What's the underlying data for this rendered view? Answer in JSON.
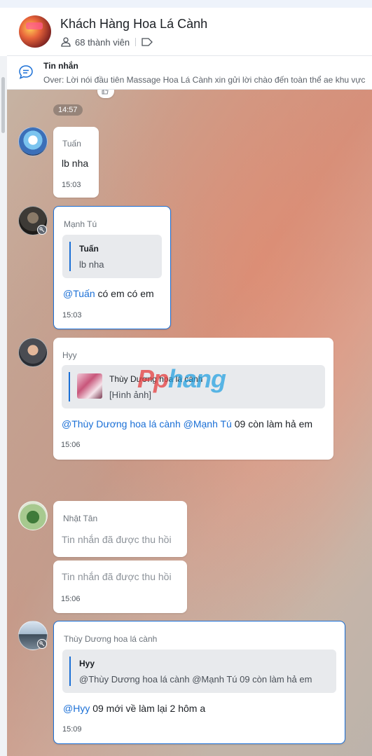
{
  "conversation": {
    "group_name": "Khách Hàng Hoa Lá Cành",
    "member_count": "68 thành viên"
  },
  "pinned": {
    "title": "Tin nhắn",
    "text": "Over: Lời nói đầu tiên Massage Hoa Lá Cành xin gửi lời chào đến toàn thể ae khu vực"
  },
  "chat": {
    "time_chip": "14:57",
    "watermark": {
      "part1": "Pp",
      "part2": "hang"
    },
    "messages": [
      {
        "sender": "Tuấn",
        "text": "lb nha",
        "time": "15:03"
      },
      {
        "sender": "Mạnh Tú",
        "quote": {
          "name": "Tuấn",
          "text": "lb nha"
        },
        "mention": "@Tuấn",
        "text": " có em có em",
        "time": "15:03"
      },
      {
        "sender": "Hyy",
        "quote": {
          "name": "Thùy Dương hoa lá cành",
          "text": "[Hình ảnh]"
        },
        "mention1": "@Thùy Dương hoa lá cành",
        "mention2": "@Mạnh Tú",
        "text": " 09 còn làm hả em",
        "time": "15:06"
      },
      {
        "sender": "Nhật Tân",
        "text": "Tin nhắn đã được thu hồi"
      },
      {
        "text": "Tin nhắn đã được thu hồi",
        "time": "15:06"
      },
      {
        "sender": "Thùy Dương hoa lá cành",
        "quote": {
          "name": "Hyy",
          "text": "@Thùy Dương hoa lá cành @Mạnh Tú 09 còn làm hả em"
        },
        "mention": "@Hyy",
        "text": " 09 mới về làm lại 2 hôm a",
        "time": "15:09"
      }
    ]
  },
  "icons": {
    "members": "person-icon",
    "tag": "tag-icon",
    "pinned": "chat-bubble-icon",
    "key": "key-icon",
    "reaction": "thumbs-up-icon"
  },
  "colors": {
    "accent": "#1a6fd6",
    "selected_border": "#1a6fd6"
  }
}
